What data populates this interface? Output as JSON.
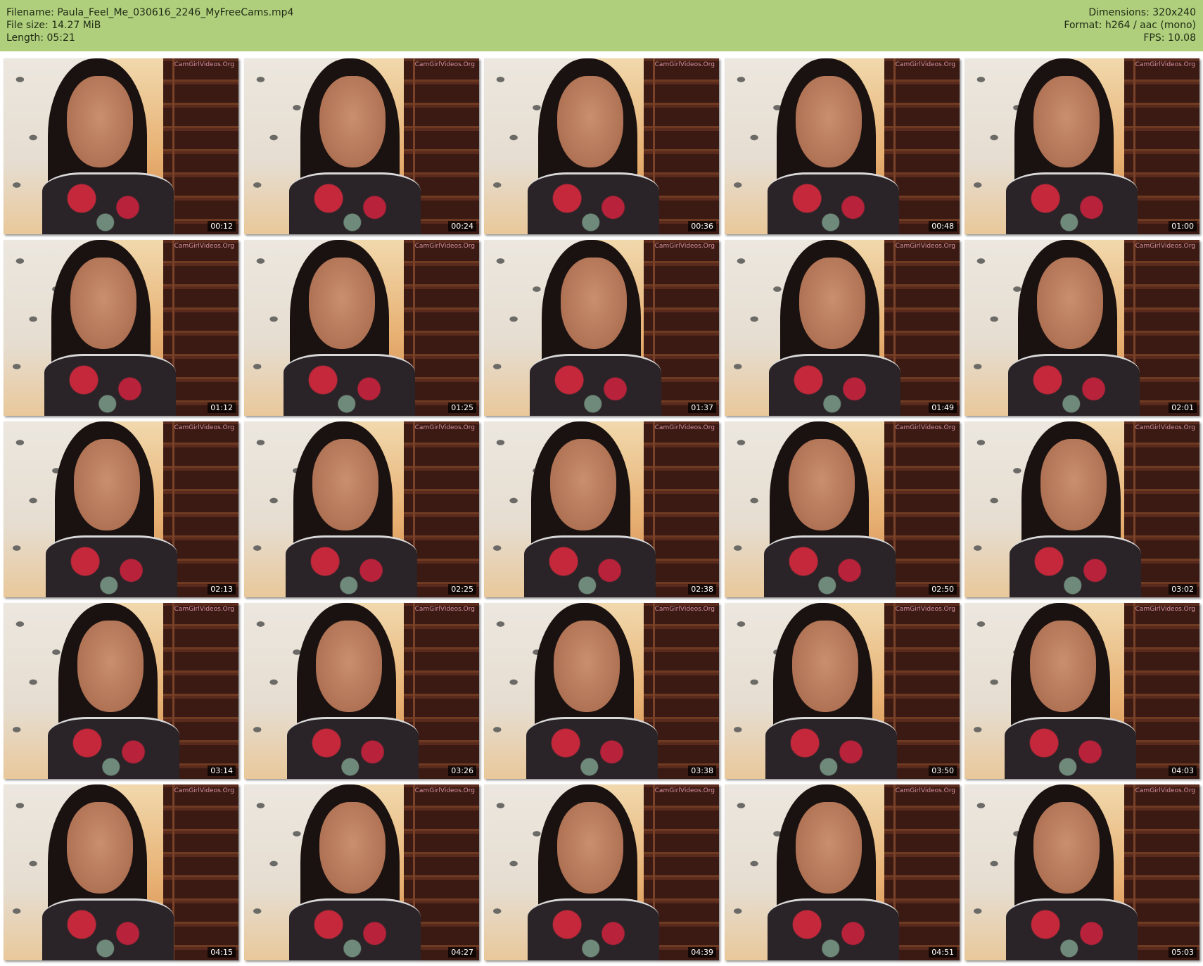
{
  "header": {
    "filename_label": "Filename:",
    "filename": "Paula_Feel_Me_030616_2246_MyFreeCams.mp4",
    "filesize_label": "File size:",
    "filesize": "14.27 MiB",
    "length_label": "Length:",
    "length": "05:21",
    "dimensions_label": "Dimensions:",
    "dimensions": "320x240",
    "format_label": "Format:",
    "format": "h264 / aac (mono)",
    "fps_label": "FPS:",
    "fps": "10.08"
  },
  "colors": {
    "header_bg": "#afcf7c",
    "page_bg": "#ffffff"
  },
  "watermark": "CamGirlVideos.Org",
  "thumbnails": [
    {
      "timestamp": "00:12"
    },
    {
      "timestamp": "00:24"
    },
    {
      "timestamp": "00:36"
    },
    {
      "timestamp": "00:48"
    },
    {
      "timestamp": "01:00"
    },
    {
      "timestamp": "01:12"
    },
    {
      "timestamp": "01:25"
    },
    {
      "timestamp": "01:37"
    },
    {
      "timestamp": "01:49"
    },
    {
      "timestamp": "02:01"
    },
    {
      "timestamp": "02:13"
    },
    {
      "timestamp": "02:25"
    },
    {
      "timestamp": "02:38"
    },
    {
      "timestamp": "02:50"
    },
    {
      "timestamp": "03:02"
    },
    {
      "timestamp": "03:14"
    },
    {
      "timestamp": "03:26"
    },
    {
      "timestamp": "03:38"
    },
    {
      "timestamp": "03:50"
    },
    {
      "timestamp": "04:03"
    },
    {
      "timestamp": "04:15"
    },
    {
      "timestamp": "04:27"
    },
    {
      "timestamp": "04:39"
    },
    {
      "timestamp": "04:51"
    },
    {
      "timestamp": "05:03"
    }
  ]
}
